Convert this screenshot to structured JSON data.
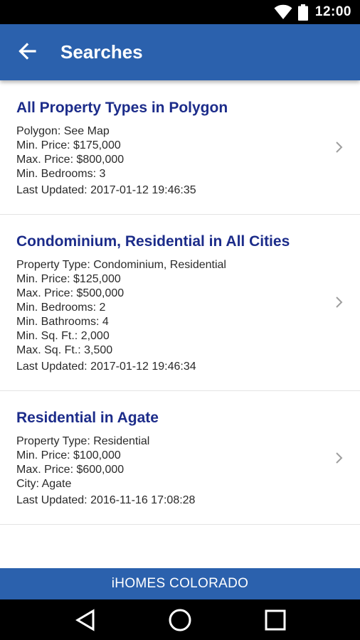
{
  "status_bar": {
    "time": "12:00",
    "icons": [
      "wifi-icon",
      "battery-icon"
    ]
  },
  "app_bar": {
    "title": "Searches",
    "back_icon": "arrow-left-icon"
  },
  "searches": [
    {
      "title": "All Property Types in Polygon",
      "details": [
        "Polygon: See Map",
        "Min. Price: $175,000",
        "Max. Price: $800,000",
        "Min. Bedrooms: 3"
      ],
      "last_updated": "Last Updated: 2017-01-12 19:46:35"
    },
    {
      "title": "Condominium, Residential in All Cities",
      "details": [
        "Property Type: Condominium, Residential",
        "Min. Price: $125,000",
        "Max. Price: $500,000",
        "Min. Bedrooms: 2",
        "Min. Bathrooms: 4",
        "Min. Sq. Ft.: 2,000",
        "Max. Sq. Ft.: 3,500"
      ],
      "last_updated": "Last Updated: 2017-01-12 19:46:34"
    },
    {
      "title": "Residential in Agate",
      "details": [
        "Property Type: Residential",
        "Min. Price: $100,000",
        "Max. Price: $600,000",
        "City: Agate"
      ],
      "last_updated": "Last Updated: 2016-11-16 17:08:28"
    }
  ],
  "footer": {
    "label": "iHOMES COLORADO"
  },
  "nav_bar": {
    "icons": [
      "back-triangle-icon",
      "home-circle-icon",
      "recents-square-icon"
    ]
  },
  "colors": {
    "primary": "#2b61ad",
    "title_text": "#1c2c8a",
    "divider": "#e4e4e4"
  }
}
